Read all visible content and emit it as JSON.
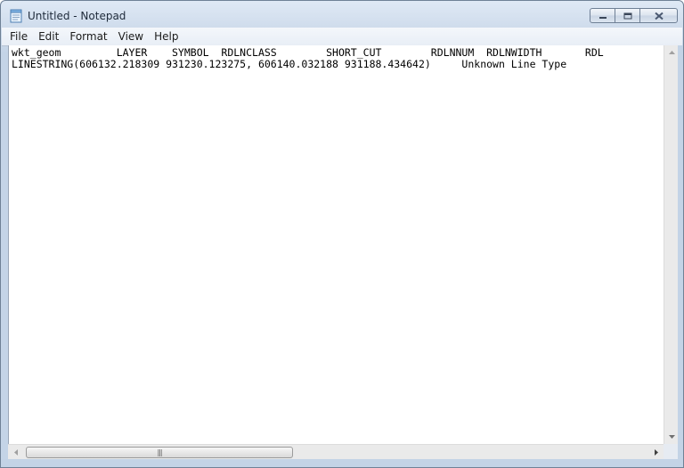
{
  "window": {
    "title": "Untitled - Notepad"
  },
  "icons": {
    "app": "notepad-icon",
    "minimize": "minimize-icon",
    "maximize": "restore-icon",
    "close": "close-icon"
  },
  "menu": {
    "items": [
      "File",
      "Edit",
      "Format",
      "View",
      "Help"
    ]
  },
  "editor": {
    "lines": [
      "wkt_geom         LAYER    SYMBOL  RDLNCLASS        SHORT_CUT        RDLNNUM  RDLNWIDTH       RDL",
      "LINESTRING(606132.218309 931230.123275, 606140.032188 931188.434642)     Unknown Line Type"
    ]
  },
  "scrollbar": {
    "grip": "|||"
  },
  "colors": {
    "frame": "#c4d4e7",
    "close_glyph": "#4a5870"
  }
}
